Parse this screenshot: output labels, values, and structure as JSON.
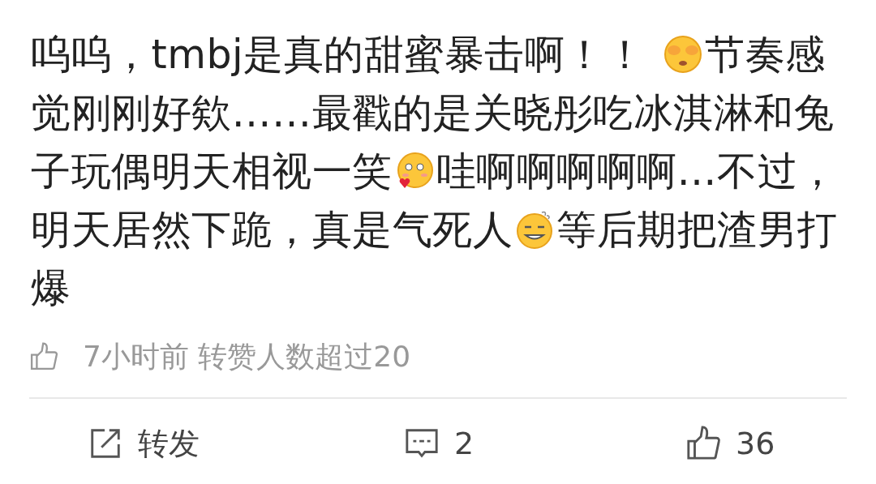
{
  "comment": {
    "segments": [
      {
        "kind": "text",
        "text": "呜呜，tmbj是真的甜蜜暴击啊！！"
      },
      {
        "kind": "shy-emoji"
      },
      {
        "kind": "text",
        "text": "节奏感觉刚刚好欸……最戳的是关晓彤吃冰淇淋和兔子玩偶明天相视一笑"
      },
      {
        "kind": "love-emoji"
      },
      {
        "kind": "text",
        "text": "哇啊啊啊啊啊…不过，明天居然下跪，真是气死人"
      },
      {
        "kind": "smug-emoji"
      },
      {
        "kind": "text",
        "text": "等后期把渣男打爆"
      }
    ],
    "meta": "7小时前 转赞人数超过20"
  },
  "actions": [
    {
      "kind": "share",
      "label": "转发"
    },
    {
      "kind": "comment",
      "label": "2"
    },
    {
      "kind": "like",
      "label": "36"
    }
  ]
}
